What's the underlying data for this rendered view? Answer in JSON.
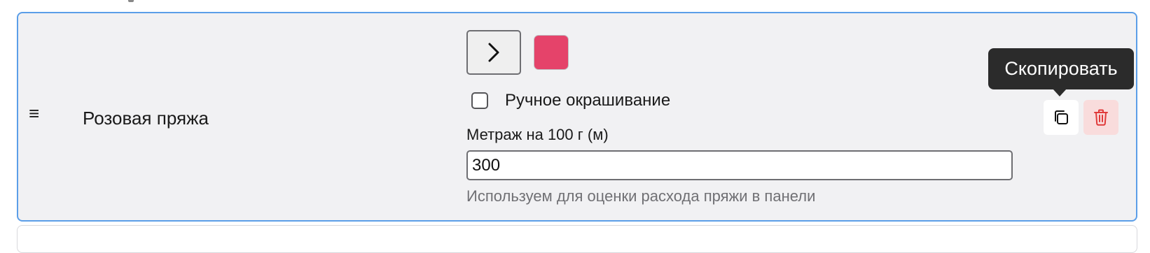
{
  "yarn_row": {
    "name": "Розовая пряжа",
    "color": "#e5436a",
    "hand_dyed": {
      "label": "Ручное окрашивание",
      "checked": false
    },
    "meterage": {
      "label": "Метраж на 100 г (м)",
      "value": "300",
      "help": "Используем для оценки расхода пряжи в панели"
    },
    "actions": {
      "copy_tooltip": "Скопировать"
    },
    "icons": {
      "drag": "drag-handle-icon",
      "expand": "chevron-right-icon",
      "copy": "copy-icon",
      "delete": "trash-icon"
    },
    "drag_symbol": "≡"
  },
  "colors": {
    "accent_border": "#5b9ee8",
    "card_background": "#f1f1f3",
    "delete_bg": "#f9dcdc",
    "delete_icon": "#e03a3a",
    "tooltip_bg": "#2b2b2b"
  }
}
